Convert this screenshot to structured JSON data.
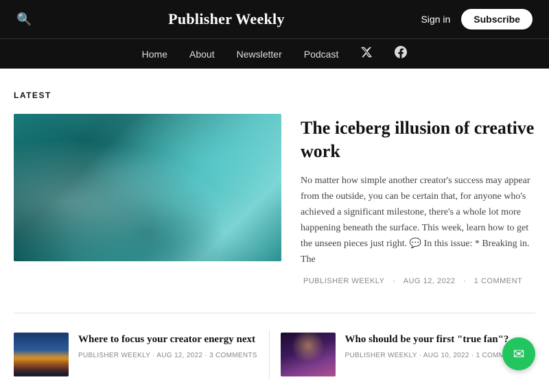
{
  "header": {
    "title": "Publisher Weekly",
    "sign_in": "Sign in",
    "subscribe": "Subscribe"
  },
  "nav": {
    "items": [
      {
        "label": "Home",
        "id": "home"
      },
      {
        "label": "About",
        "id": "about"
      },
      {
        "label": "Newsletter",
        "id": "newsletter"
      },
      {
        "label": "Podcast",
        "id": "podcast"
      }
    ]
  },
  "latest": {
    "section_label": "LATEST",
    "featured": {
      "title": "The iceberg illusion of creative work",
      "excerpt": "No matter how simple another creator's success may appear from the outside, you can be certain that, for anyone who's achieved a significant milestone, there's a whole lot more happening beneath the surface. This week, learn how to get the unseen pieces just right. 💬 In this issue: * Breaking in. The",
      "publisher": "PUBLISHER WEEKLY",
      "date": "AUG 12, 2022",
      "comments": "1 COMMENT"
    },
    "small_articles": [
      {
        "title": "Where to focus your creator energy next",
        "publisher": "PUBLISHER WEEKLY",
        "date": "AUG 12, 2022",
        "comments": "3 COMMENTS",
        "thumb": "city"
      },
      {
        "title": "Who should be your first \"true fan\"?",
        "publisher": "PUBLISHER WEEKLY",
        "date": "AUG 10, 2022",
        "comments": "1 COMMENT",
        "thumb": "concert"
      }
    ]
  },
  "fab": {
    "icon": "✉"
  },
  "icons": {
    "search": "🔍",
    "twitter": "𝕏",
    "facebook": "f",
    "email": "✉"
  }
}
